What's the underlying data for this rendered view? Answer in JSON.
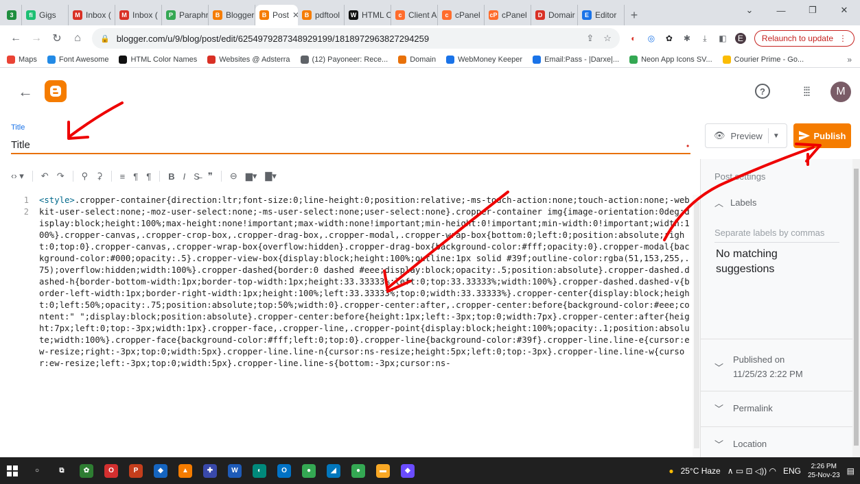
{
  "browser": {
    "tabs": [
      {
        "label": "",
        "color": "#1e8e3e",
        "glyph": "3",
        "active": false
      },
      {
        "label": "Gigs",
        "color": "#1dbf73",
        "glyph": "fi",
        "active": false
      },
      {
        "label": "Inbox (",
        "color": "#d93025",
        "glyph": "M",
        "active": false
      },
      {
        "label": "Inbox (",
        "color": "#d93025",
        "glyph": "M",
        "active": false
      },
      {
        "label": "Paraphr",
        "color": "#34a853",
        "glyph": "P",
        "active": false
      },
      {
        "label": "Blogger",
        "color": "#f57c00",
        "glyph": "B",
        "active": false
      },
      {
        "label": "Post",
        "color": "#f57c00",
        "glyph": "B",
        "active": true
      },
      {
        "label": "pdftool",
        "color": "#f57c00",
        "glyph": "B",
        "active": false
      },
      {
        "label": "HTML C",
        "color": "#111111",
        "glyph": "W",
        "active": false
      },
      {
        "label": "Client A",
        "color": "#ff6c2c",
        "glyph": "c",
        "active": false
      },
      {
        "label": "cPanel",
        "color": "#ff6c2c",
        "glyph": "c",
        "active": false
      },
      {
        "label": "cPanel",
        "color": "#ff6c2c",
        "glyph": "cP",
        "active": false
      },
      {
        "label": "Domair",
        "color": "#d93025",
        "glyph": "D",
        "active": false
      },
      {
        "label": "Editor",
        "color": "#1a73e8",
        "glyph": "E",
        "active": false
      }
    ],
    "url": "blogger.com/u/9/blog/post/edit/6254979287348929199/1818972963827294259",
    "relaunch_label": "Relaunch to update",
    "profile_initial": "E",
    "bookmarks": [
      {
        "label": "Maps",
        "color": "#ea4335"
      },
      {
        "label": "Font Awesome",
        "color": "#228ae6"
      },
      {
        "label": "HTML Color Names",
        "color": "#111111"
      },
      {
        "label": "Websites @ Adsterra",
        "color": "#d93025"
      },
      {
        "label": "(12) Payoneer: Rece...",
        "color": "#5f6368"
      },
      {
        "label": "Domain",
        "color": "#e8710a"
      },
      {
        "label": "WebMoney Keeper",
        "color": "#1a73e8"
      },
      {
        "label": "Email:Pass - |Darxe|...",
        "color": "#1a73e8"
      },
      {
        "label": "Neon App Icons SV...",
        "color": "#34a853"
      },
      {
        "label": "Courier Prime - Go...",
        "color": "#fbbc04"
      }
    ]
  },
  "app": {
    "avatar_initial": "M"
  },
  "post": {
    "title_label": "Title",
    "title_value": "Title"
  },
  "actions": {
    "preview_label": "Preview",
    "publish_label": "Publish"
  },
  "editor": {
    "line_numbers": [
      "1",
      "2"
    ],
    "code_tag": "<style>",
    "code_text": ".cropper-container{direction:ltr;font-size:0;line-height:0;position:relative;-ms-touch-action:none;touch-action:none;-webkit-user-select:none;-moz-user-select:none;-ms-user-select:none;user-select:none}.cropper-container img{image-orientation:0deg;display:block;height:100%;max-height:none!important;max-width:none!important;min-height:0!important;min-width:0!important;width:100%}.cropper-canvas,.cropper-crop-box,.cropper-drag-box,.cropper-modal,.cropper-wrap-box{bottom:0;left:0;position:absolute;right:0;top:0}.cropper-canvas,.cropper-wrap-box{overflow:hidden}.cropper-drag-box{background-color:#fff;opacity:0}.cropper-modal{background-color:#000;opacity:.5}.cropper-view-box{display:block;height:100%;outline:1px solid #39f;outline-color:rgba(51,153,255,.75);overflow:hidden;width:100%}.cropper-dashed{border:0 dashed #eee;display:block;opacity:.5;position:absolute}.cropper-dashed.dashed-h{border-bottom-width:1px;border-top-width:1px;height:33.33333%;left:0;top:33.33333%;width:100%}.cropper-dashed.dashed-v{border-left-width:1px;border-right-width:1px;height:100%;left:33.33333%;top:0;width:33.33333%}.cropper-center{display:block;height:0;left:50%;opacity:.75;position:absolute;top:50%;width:0}.cropper-center:after,.cropper-center:before{background-color:#eee;content:\" \";display:block;position:absolute}.cropper-center:before{height:1px;left:-3px;top:0;width:7px}.cropper-center:after{height:7px;left:0;top:-3px;width:1px}.cropper-face,.cropper-line,.cropper-point{display:block;height:100%;opacity:.1;position:absolute;width:100%}.cropper-face{background-color:#fff;left:0;top:0}.cropper-line{background-color:#39f}.cropper-line.line-e{cursor:ew-resize;right:-3px;top:0;width:5px}.cropper-line.line-n{cursor:ns-resize;height:5px;left:0;top:-3px}.cropper-line.line-w{cursor:ew-resize;left:-3px;top:0;width:5px}.cropper-line.line-s{bottom:-3px;cursor:ns-"
  },
  "sidebar": {
    "title": "Post settings",
    "labels_header": "Labels",
    "labels_placeholder": "Separate labels by commas",
    "no_match": "No matching suggestions",
    "published_label": "Published on",
    "published_date": "11/25/23 2:22 PM",
    "permalink": "Permalink",
    "location": "Location"
  },
  "taskbar": {
    "weather": "25°C  Haze",
    "language": "ENG",
    "time": "2:26 PM",
    "date": "25-Nov-23",
    "apps": [
      {
        "name": "search-icon",
        "color": "transparent",
        "glyph": "○"
      },
      {
        "name": "task-view-icon",
        "color": "transparent",
        "glyph": "⧉"
      },
      {
        "name": "app-icon",
        "color": "#2e7d32",
        "glyph": "✿"
      },
      {
        "name": "opera-icon",
        "color": "#d32f2f",
        "glyph": "O"
      },
      {
        "name": "powerpoint-icon",
        "color": "#c43e1c",
        "glyph": "P"
      },
      {
        "name": "app-icon",
        "color": "#1565c0",
        "glyph": "◆"
      },
      {
        "name": "vlc-icon",
        "color": "#f57c00",
        "glyph": "▲"
      },
      {
        "name": "app-icon",
        "color": "#3949ab",
        "glyph": "✚"
      },
      {
        "name": "word-icon",
        "color": "#1e5bb8",
        "glyph": "W"
      },
      {
        "name": "app-icon",
        "color": "#00897b",
        "glyph": "◐"
      },
      {
        "name": "outlook-icon",
        "color": "#0072c6",
        "glyph": "O"
      },
      {
        "name": "chrome-icon",
        "color": "#34a853",
        "glyph": "●"
      },
      {
        "name": "app-icon",
        "color": "#0277bd",
        "glyph": "◢"
      },
      {
        "name": "chrome-icon",
        "color": "#34a853",
        "glyph": "●"
      },
      {
        "name": "file-explorer-icon",
        "color": "#f9a825",
        "glyph": "▬"
      },
      {
        "name": "app-icon",
        "color": "#6a4cff",
        "glyph": "◆"
      }
    ]
  }
}
